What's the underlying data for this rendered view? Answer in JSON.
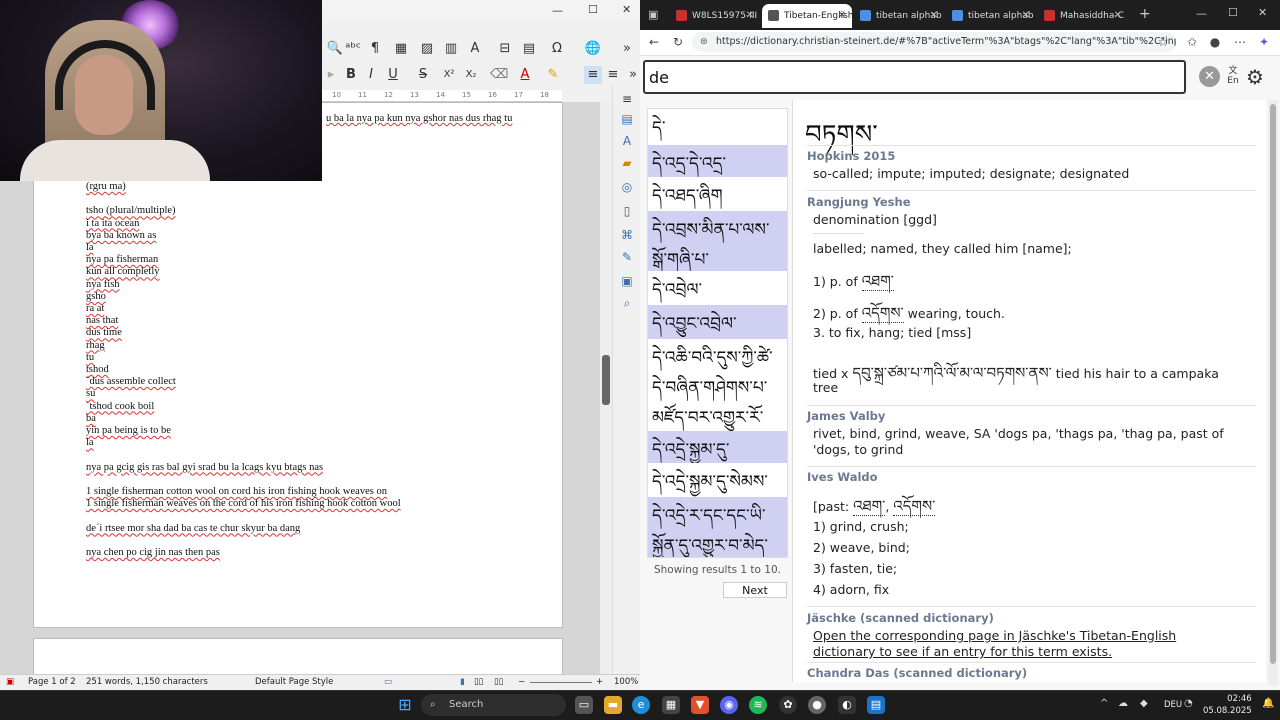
{
  "writer": {
    "toolbar_icons": [
      "find-replace-icon",
      "spellcheck-icon",
      "formatting-marks-icon",
      "table-icon",
      "image-icon",
      "chart-icon",
      "textbox-icon",
      "page-break-icon",
      "field-icon",
      "special-char-icon",
      "hyperlink-icon"
    ],
    "format_buttons": {
      "bold": "B",
      "italic": "I",
      "underline": "U",
      "strike": "S",
      "superscript": "X²",
      "subscript": "X₂"
    },
    "ruler_marks": [
      "10",
      "11",
      "12",
      "13",
      "14",
      "15",
      "16",
      "17",
      "18"
    ],
    "top_line": "u ba la nya pa kun nya gshor nas dus rhag tu",
    "lines": [
      "(rgru ma)",
      "",
      "tsho (plural/multiple)",
      "i ta ita ocean",
      "bya ba known as",
      "la",
      "nya pa fisherman",
      "kun all completly",
      "nya fish",
      "gsho",
      "ra at",
      "nas that",
      "dus time",
      "rhag",
      "tu",
      "tshod",
      "´dus assemble collect",
      "su",
      "´tshod cook boil",
      "ba",
      "yin pa being is to be",
      "la",
      "",
      "nya pa gcig gis ras bal gyi srad bu la lcags kyu btags nas",
      "",
      "1 single fisherman cotton wool on cord his iron fishing hook weaves on",
      "1 single fisherman weaves on the cord of his iron fishing hook cotton wool",
      "",
      "de´i rtsee mor sha dad ba cas te chur skyur ba dang",
      "",
      "nya chen po cig jin nas then pas"
    ],
    "status": {
      "page": "Page 1 of 2",
      "words": "251 words, 1,150 characters",
      "style": "Default Page Style",
      "zoom": "100%"
    }
  },
  "browser": {
    "tabs": [
      {
        "label": "W8LS15975-III",
        "color": "#c9302c",
        "active": false
      },
      {
        "label": "Tibetan-English",
        "color": "#555555",
        "active": true
      },
      {
        "label": "tibetan alphab",
        "color": "#4a8fe7",
        "active": false
      },
      {
        "label": "tibetan alphab",
        "color": "#4a8fe7",
        "active": false
      },
      {
        "label": "Mahasiddha-C",
        "color": "#c9302c",
        "active": false
      }
    ],
    "url": "https://dictionary.christian-steinert.de/#%7B\"activeTerm\"%3A\"btags\"%2C\"lang\"%3A\"tib\"%2C\"inputLang..."
  },
  "dictionary": {
    "search_value": "de",
    "lang_label_top": "文",
    "lang_label_bottom": "En",
    "results": [
      "དེ་",
      "དེ་འདྲ་དེ་འདྲ་",
      "དེ་འཐད་ཞིག",
      "དེ་འབྲས་མིན་པ་ལས་སྒོ་གཞི་པ་",
      "དེ་འབྲེལ་",
      "དེ་འབྱུང་འབྲེལ་",
      "དེ་འཆི་བའི་དུས་ཀྱི་ཚེ་དེ་བཞིན་གཤེགས་པ་མཛོད་བར་འགྱུར་རོ་",
      "དེ་འདྲེ་སྐྱམ་དུ་",
      "དེ་འདྲེ་སྐྱམ་དུ་སེམས་",
      "དེ་འདྲེ་ར་དང་དང་ཡི་སྐྱོན་དུ་འགྱུར་བ་མེད་"
    ],
    "showing": "Showing results 1 to 10.",
    "next_label": "Next",
    "headword": "བཏགས་",
    "sources": {
      "hopkins": {
        "name": "Hopkins 2015",
        "def": "so-called; impute; imputed; designate; designated"
      },
      "rangjung": {
        "name": "Rangjung Yeshe",
        "def1": "denomination [ggd]",
        "def2": "labelled; named, they called him [name];",
        "def3_pre": "1) p. of ",
        "def3_tib": "འཐག་",
        "def4_pre": "2) p. of ",
        "def4_tib": "འདོགས་",
        "def4_post": " wearing, touch.",
        "def5": "3. to fix, hang; tied [mss]",
        "def6_pre": "tied x ",
        "def6_tib": "དབུ་སྐྲ་ཙམ་པ་ཀའི་ལོ་མ་ལ་བཏགས་ནས་",
        "def6_post": " tied his hair to a campaka",
        "def6_cont": "tree"
      },
      "valby": {
        "name": "James Valby",
        "def1": "rivet, bind, grind, weave, SA 'dogs pa, 'thags pa, 'thag pa, past of",
        "def2": "'dogs, to grind"
      },
      "waldo": {
        "name": "Ives Waldo",
        "past_pre": "[past: ",
        "past_tib1": "འཐག་",
        "past_sep": ", ",
        "past_tib2": "འདོགས་",
        "past_post": "",
        "d1": "1) grind, crush;",
        "d2": "2) weave, bind;",
        "d3": "3) fasten, tie;",
        "d4": "4) adorn, fix"
      },
      "jaschke": {
        "name": "Jäschke (scanned dictionary)",
        "link1": "Open the corresponding page in Jäschke's Tibetan-English",
        "link2": "dictionary to see if an entry for this term exists."
      },
      "das": {
        "name": "Chandra Das (scanned dictionary)"
      }
    }
  },
  "taskbar": {
    "search_placeholder": "Search",
    "lang": "DEU",
    "time": "02:46",
    "date": "05.08.2025"
  }
}
